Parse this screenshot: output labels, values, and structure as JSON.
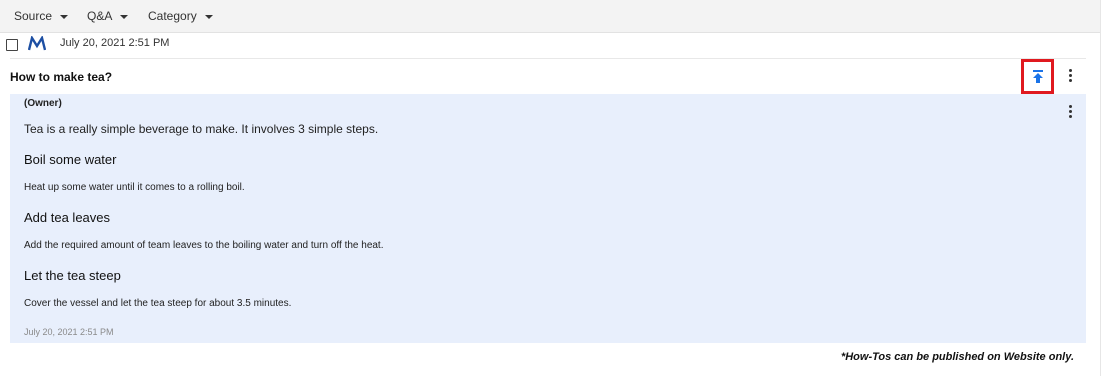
{
  "filters": {
    "source": "Source",
    "qa": "Q&A",
    "category": "Category"
  },
  "post": {
    "date": "July 20, 2021 2:51 PM",
    "question": "How to make tea?"
  },
  "answer": {
    "author_role": "(Owner)",
    "intro": "Tea is a really simple beverage to make. It involves 3 simple steps.",
    "steps": [
      {
        "title": "Boil some water",
        "body": "Heat up some water until it comes to a rolling boil."
      },
      {
        "title": "Add tea leaves",
        "body": "Add the required amount of team leaves to the boiling water and turn off the heat."
      },
      {
        "title": "Let the tea steep",
        "body": "Cover the vessel and let the tea steep for about 3.5 minutes."
      }
    ],
    "date": "July 20, 2021 2:51 PM"
  },
  "footnote": "*How-Tos can be published on Website only.",
  "icons": {
    "filter_caret": "caret-down-icon",
    "source_logo": "m-logo-icon",
    "publish": "publish-to-top-icon",
    "more": "more-vert-icon"
  },
  "colors": {
    "accent_blue": "#1a73e8",
    "answer_bg": "#e8effc",
    "highlight_border": "#e0191f",
    "logo_blue": "#1d4fa3"
  }
}
